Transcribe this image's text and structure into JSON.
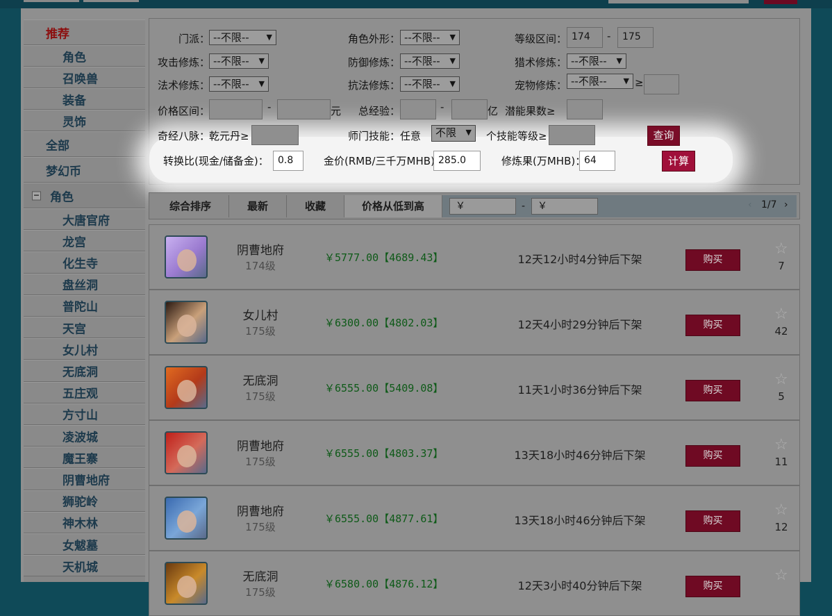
{
  "sidebar": {
    "items": [
      {
        "label": "推荐",
        "type": "top",
        "active": true
      },
      {
        "label": "角色",
        "type": "sub"
      },
      {
        "label": "召唤兽",
        "type": "sub"
      },
      {
        "label": "装备",
        "type": "sub"
      },
      {
        "label": "灵饰",
        "type": "sub"
      },
      {
        "label": "全部",
        "type": "top"
      },
      {
        "label": "梦幻币",
        "type": "top"
      },
      {
        "label": "角色",
        "type": "group"
      },
      {
        "label": "大唐官府",
        "type": "sub"
      },
      {
        "label": "龙宫",
        "type": "sub"
      },
      {
        "label": "化生寺",
        "type": "sub"
      },
      {
        "label": "盘丝洞",
        "type": "sub"
      },
      {
        "label": "普陀山",
        "type": "sub"
      },
      {
        "label": "天宫",
        "type": "sub"
      },
      {
        "label": "女儿村",
        "type": "sub"
      },
      {
        "label": "无底洞",
        "type": "sub"
      },
      {
        "label": "五庄观",
        "type": "sub"
      },
      {
        "label": "方寸山",
        "type": "sub"
      },
      {
        "label": "凌波城",
        "type": "sub"
      },
      {
        "label": "魔王寨",
        "type": "sub"
      },
      {
        "label": "阴曹地府",
        "type": "sub"
      },
      {
        "label": "狮驼岭",
        "type": "sub"
      },
      {
        "label": "神木林",
        "type": "sub"
      },
      {
        "label": "女魃墓",
        "type": "sub"
      },
      {
        "label": "天机城",
        "type": "sub"
      }
    ],
    "collapse_icon": "−"
  },
  "filter": {
    "school_label": "门派：",
    "school_value": "--不限--",
    "look_label": "角色外形：",
    "look_value": "--不限--",
    "level_label": "等级区间：",
    "level_min": "174",
    "level_max": "175",
    "range_dash": "-",
    "atk_label": "攻击修炼：",
    "atk_value": "--不限--",
    "def_label": "防御修炼：",
    "def_value": "--不限--",
    "hunt_label": "猎术修炼：",
    "hunt_value": "--不限--",
    "mag_label": "法术修炼：",
    "mag_value": "--不限--",
    "res_label": "抗法修炼：",
    "res_value": "--不限--",
    "pet_label": "宠物修炼：",
    "pet_value": "--不限--",
    "pet_ge": "≥",
    "price_label": "价格区间：",
    "price_unit": "元",
    "exp_label": "总经验：",
    "exp_unit": "亿",
    "pot_label": "潜能果数≥",
    "meridian_label": "奇经八脉：",
    "meridian_item": "乾元丹≥",
    "skill_label": "师门技能：",
    "skill_any": "任意",
    "skill_value": "不限",
    "single_skill_label": "个技能等级≥",
    "query_button": "查询",
    "ratio_label": "转换比(现金/储备金)：",
    "ratio_value": "0.8",
    "gold_label": "金价(RMB/三千万MHB)：",
    "gold_value": "285.0",
    "fruit_label": "修炼果(万MHB)：",
    "fruit_value": "64",
    "calc_button": "计算"
  },
  "sortbar": {
    "tabs": [
      "综合排序",
      "最新",
      "收藏",
      "价格从低到高"
    ],
    "price_from": "￥",
    "price_to": "￥",
    "dash": "-",
    "pager": "1/7",
    "prev": "‹",
    "next": "›"
  },
  "listings": [
    {
      "school": "阴曹地府",
      "level": "174级",
      "price": "￥5777.00【4689.43】",
      "time": "12天12小时4分钟后下架",
      "buy": "购买",
      "favs": "7",
      "avatar_color": "#9b7bd0",
      "avatar_hair": "#c8b0f0"
    },
    {
      "school": "女儿村",
      "level": "175级",
      "price": "￥6300.00【4802.03】",
      "time": "12天4小时29分钟后下架",
      "buy": "购买",
      "favs": "42",
      "avatar_color": "#c9a07a",
      "avatar_hair": "#2c1a12"
    },
    {
      "school": "无底洞",
      "level": "175级",
      "price": "￥6555.00【5409.08】",
      "time": "11天1小时36分钟后下架",
      "buy": "购买",
      "favs": "5",
      "avatar_color": "#b33a1a",
      "avatar_hair": "#e06a20"
    },
    {
      "school": "阴曹地府",
      "level": "175级",
      "price": "￥6555.00【4803.37】",
      "time": "13天18小时46分钟后下架",
      "buy": "购买",
      "favs": "11",
      "avatar_color": "#d46a5a",
      "avatar_hair": "#c0201a"
    },
    {
      "school": "阴曹地府",
      "level": "175级",
      "price": "￥6555.00【4877.61】",
      "time": "13天18小时46分钟后下架",
      "buy": "购买",
      "favs": "12",
      "avatar_color": "#7aa6d8",
      "avatar_hair": "#3a6ab0"
    },
    {
      "school": "无底洞",
      "level": "175级",
      "price": "￥6580.00【4876.12】",
      "time": "12天3小时40分钟后下架",
      "buy": "购买",
      "favs": "",
      "avatar_color": "#c98a2a",
      "avatar_hair": "#6a3a10"
    }
  ]
}
